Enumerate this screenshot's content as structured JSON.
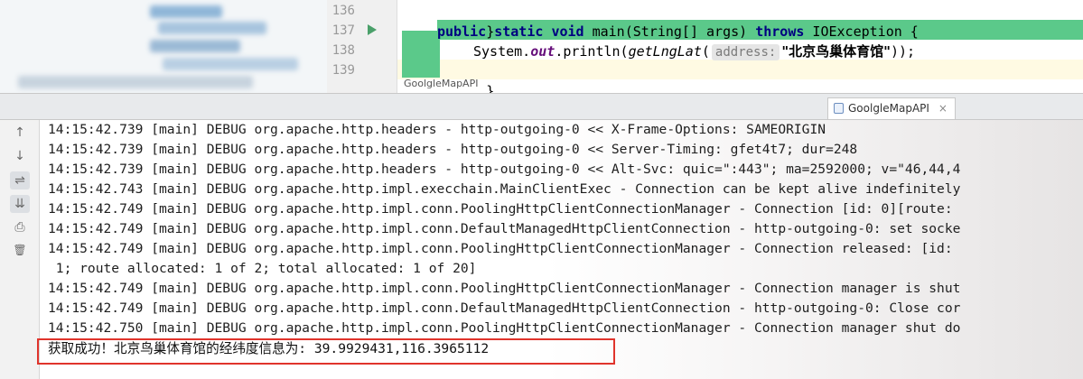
{
  "editor": {
    "line_numbers": [
      "136",
      "137",
      "138",
      "139"
    ],
    "code": {
      "line136": "}",
      "kw_public": "public",
      "kw_static": "static",
      "kw_void": "void",
      "method": " main(String[] args) ",
      "kw_throws": "throws",
      "exception": " IOException {",
      "sys_prefix": "System.",
      "out_field": "out",
      "println": ".println(",
      "get_call": "getLngLat",
      "paren_open": "(",
      "param_hint": "address:",
      "string_literal": "\"北京鸟巢体育馆\"",
      "line_end": "));",
      "line139": "}"
    },
    "breadcrumb": "GoolgleMapAPI"
  },
  "run_window": {
    "tab_label": "GoolgleMapAPI",
    "tab_close": "×",
    "toolbar": {
      "up": "↑",
      "down": "↓",
      "soft_wrap": "⇌",
      "scroll_end": "⇊",
      "print": "⎙",
      "clear": "🗑"
    },
    "log_lines": [
      "14:15:42.739 [main] DEBUG org.apache.http.headers - http-outgoing-0 << X-Frame-Options: SAMEORIGIN",
      "14:15:42.739 [main] DEBUG org.apache.http.headers - http-outgoing-0 << Server-Timing: gfet4t7; dur=248",
      "14:15:42.739 [main] DEBUG org.apache.http.headers - http-outgoing-0 << Alt-Svc: quic=\":443\"; ma=2592000; v=\"46,44,4",
      "14:15:42.743 [main] DEBUG org.apache.http.impl.execchain.MainClientExec - Connection can be kept alive indefinitely",
      "14:15:42.749 [main] DEBUG org.apache.http.impl.conn.PoolingHttpClientConnectionManager - Connection [id: 0][route:",
      "14:15:42.749 [main] DEBUG org.apache.http.impl.conn.DefaultManagedHttpClientConnection - http-outgoing-0: set socke",
      "14:15:42.749 [main] DEBUG org.apache.http.impl.conn.PoolingHttpClientConnectionManager - Connection released: [id:",
      " 1; route allocated: 1 of 2; total allocated: 1 of 20]",
      "14:15:42.749 [main] DEBUG org.apache.http.impl.conn.PoolingHttpClientConnectionManager - Connection manager is shut",
      "14:15:42.749 [main] DEBUG org.apache.http.impl.conn.DefaultManagedHttpClientConnection - http-outgoing-0: Close cor",
      "14:15:42.750 [main] DEBUG org.apache.http.impl.conn.PoolingHttpClientConnectionManager - Connection manager shut do"
    ],
    "result_line": "获取成功！北京鸟巢体育馆的经纬度信息为: 39.9929431,116.3965112"
  },
  "colors": {
    "highlight_green": "#5bc98a",
    "result_border": "#e0342c",
    "keyword": "#000080"
  }
}
